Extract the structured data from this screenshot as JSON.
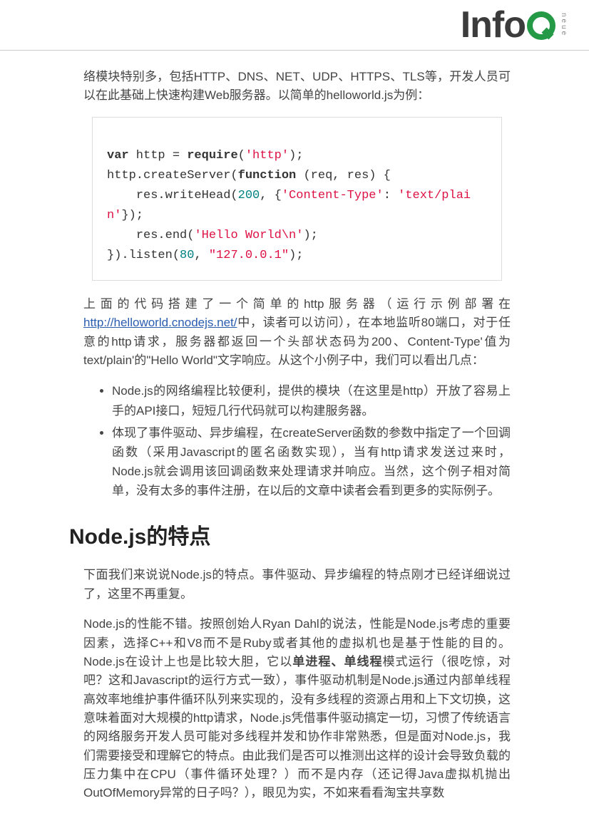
{
  "logo": {
    "text": "Info",
    "side": "neue"
  },
  "p1": "络模块特别多，包括HTTP、DNS、NET、UDP、HTTPS、TLS等，开发人员可以在此基础上快速构建Web服务器。以简单的helloworld.js为例：",
  "code": {
    "var": "var",
    "http_var": " http = ",
    "require": "require",
    "lparen1": "(",
    "http_str": "'http'",
    "rparen_semi": ");",
    "line2a": "http.createServer(",
    "function": "function",
    "line2b": " (req, res) {",
    "line3a": "    res.writeHead(",
    "num200": "200",
    "line3b": ", {",
    "ctype": "'Content-Type'",
    "colon": ": ",
    "textplain": "'text/plain'",
    "line3c": "});",
    "line4a": "    res.end(",
    "hello": "'Hello World\\n'",
    "line4b": ");",
    "line5a": "}).listen(",
    "num80": "80",
    "comma": ", ",
    "ip": "\"127.0.0.1\"",
    "line5b": ");"
  },
  "p2a": "上面的代码搭建了一个简单的http服务器（运行示例部署在",
  "link": "http://helloworld.cnodejs.net/",
  "p2b": "中，读者可以访问），在本地监听80端口，对于任意的http请求，服务器都返回一个头部状态码为200、Content-Type'值为text/plain'的\"Hello World\"文字响应。从这个小例子中，我们可以看出几点：",
  "li1": "Node.js的网络编程比较便利，提供的模块（在这里是http）开放了容易上手的API接口，短短几行代码就可以构建服务器。",
  "li2": "体现了事件驱动、异步编程，在createServer函数的参数中指定了一个回调函数（采用Javascript的匿名函数实现），当有http请求发送过来时，Node.js就会调用该回调函数来处理请求并响应。当然，这个例子相对简单，没有太多的事件注册，在以后的文章中读者会看到更多的实际例子。",
  "h2": "Node.js的特点",
  "p3": "下面我们来说说Node.js的特点。事件驱动、异步编程的特点刚才已经详细说过了，这里不再重复。",
  "p4a": "Node.js的性能不错。按照创始人Ryan Dahl的说法，性能是Node.js考虑的重要因素，选择C++和V8而不是Ruby或者其他的虚拟机也是基于性能的目的。Node.js在设计上也是比较大胆，它以",
  "p4b": "单进程、单线程",
  "p4c": "模式运行（很吃惊，对吧？这和Javascript的运行方式一致），事件驱动机制是Node.js通过内部单线程高效率地维护事件循环队列来实现的，没有多线程的资源占用和上下文切换，这意味着面对大规模的http请求，Node.js凭借事件驱动搞定一切，习惯了传统语言的网络服务开发人员可能对多线程并发和协作非常熟悉，但是面对Node.js，我们需要接受和理解它的特点。由此我们是否可以推测出这样的设计会导致负载的压力集中在CPU（事件循环处理？）而不是内存（还记得Java虚拟机抛出OutOfMemory异常的日子吗？），眼见为实，不如来看看淘宝共享数"
}
